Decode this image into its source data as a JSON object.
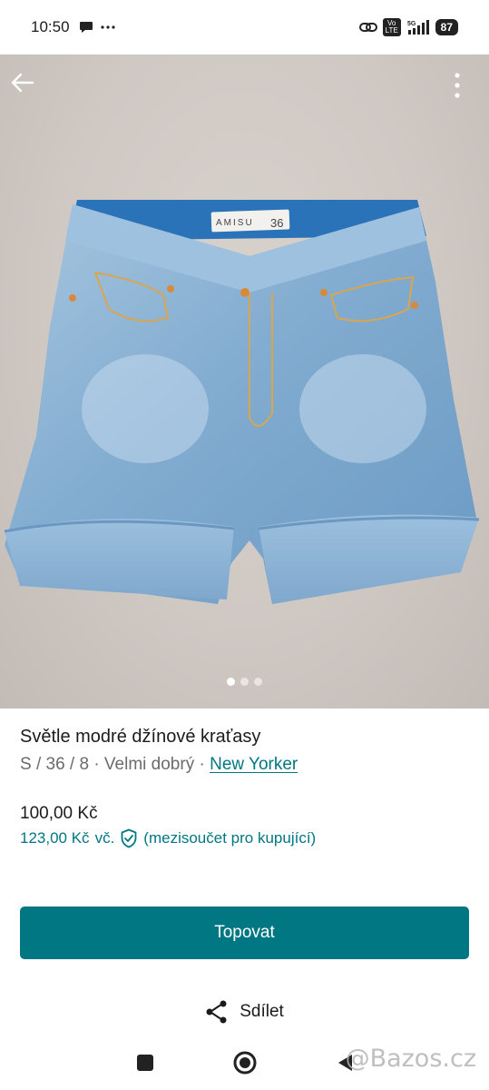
{
  "status_bar": {
    "time": "10:50",
    "left_icons": [
      "chat-bubble-icon",
      "more-dots-icon"
    ],
    "right_icons": [
      "link-icon",
      "volte-icon",
      "signal-5g-icon"
    ],
    "volte_text": "Vo LTE",
    "network": "5G",
    "battery": "87"
  },
  "gallery": {
    "image_count": 3,
    "active_index": 0,
    "label_brand": "AMISU",
    "label_size": "36"
  },
  "item": {
    "title": "Světle modré džínové kraťasy",
    "meta_prefix": "S / 36 / 8 · Velmi dobrý · ",
    "brand": "New Yorker",
    "price": "100,00 Kč",
    "buyer_price": "123,00 Kč",
    "buyer_incl": "vč.",
    "buyer_note": "(mezisoučet pro kupující)"
  },
  "actions": {
    "primary_label": "Topovat",
    "share_label": "Sdílet"
  },
  "watermark": "@Bazos.cz",
  "colors": {
    "accent": "#007782",
    "denim": "#8fb6d6"
  }
}
